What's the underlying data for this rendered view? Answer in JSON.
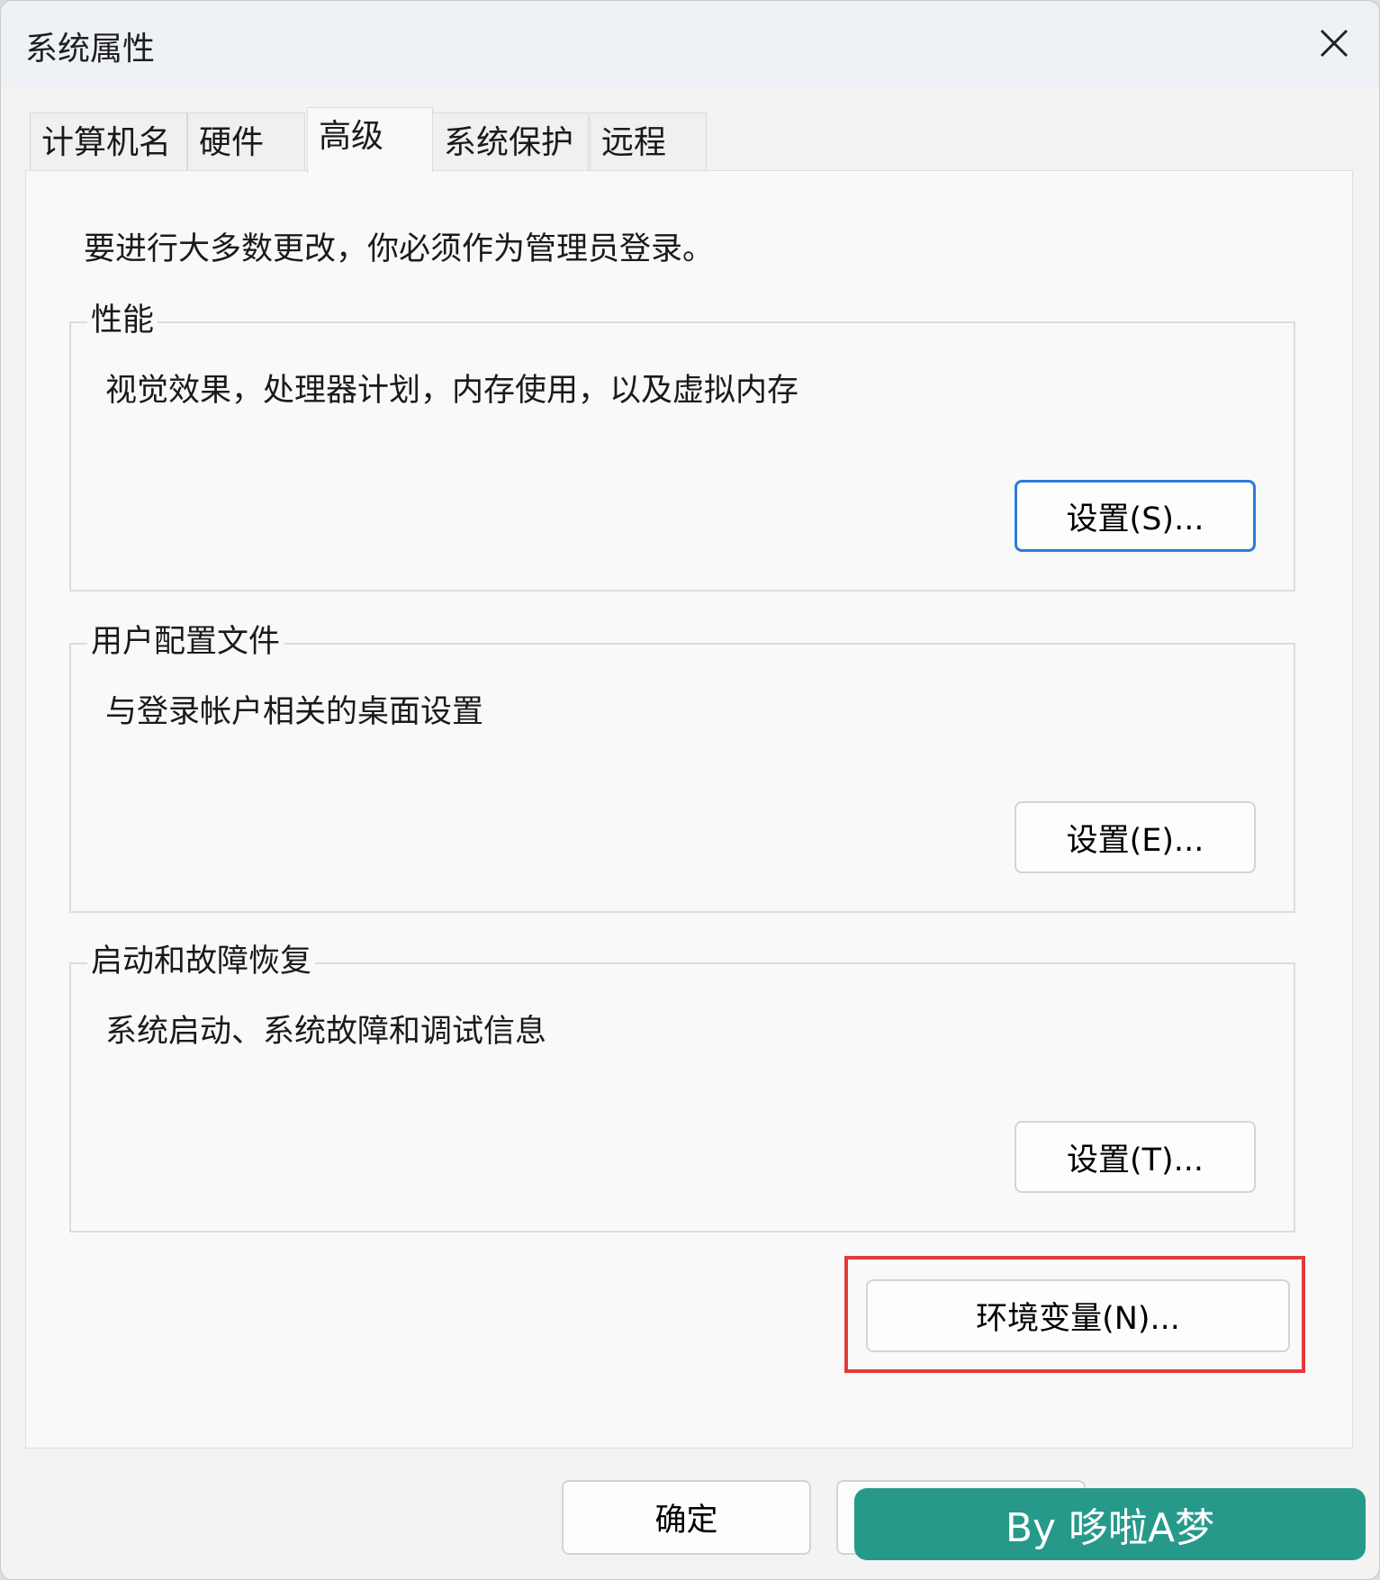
{
  "window": {
    "title": "系统属性",
    "close_glyph": "✕"
  },
  "tabs": [
    {
      "label": "计算机名",
      "active": false
    },
    {
      "label": "硬件",
      "active": false
    },
    {
      "label": "高级",
      "active": true
    },
    {
      "label": "系统保护",
      "active": false
    },
    {
      "label": "远程",
      "active": false
    }
  ],
  "panel": {
    "admin_note": "要进行大多数更改，你必须作为管理员登录。",
    "groups": [
      {
        "title": "性能",
        "description": "视觉效果，处理器计划，内存使用，以及虚拟内存",
        "button_label": "设置(S)..."
      },
      {
        "title": "用户配置文件",
        "description": "与登录帐户相关的桌面设置",
        "button_label": "设置(E)..."
      },
      {
        "title": "启动和故障恢复",
        "description": "系统启动、系统故障和调试信息",
        "button_label": "设置(T)..."
      }
    ],
    "env_button_label": "环境变量(N)..."
  },
  "footer": {
    "ok_label": "确定",
    "cancel_label": ""
  },
  "watermark": {
    "text": "By 哆啦A梦"
  },
  "colors": {
    "highlight": "#e23b3b",
    "focus": "#2e7bd6",
    "watermark_bg": "#26998a"
  }
}
